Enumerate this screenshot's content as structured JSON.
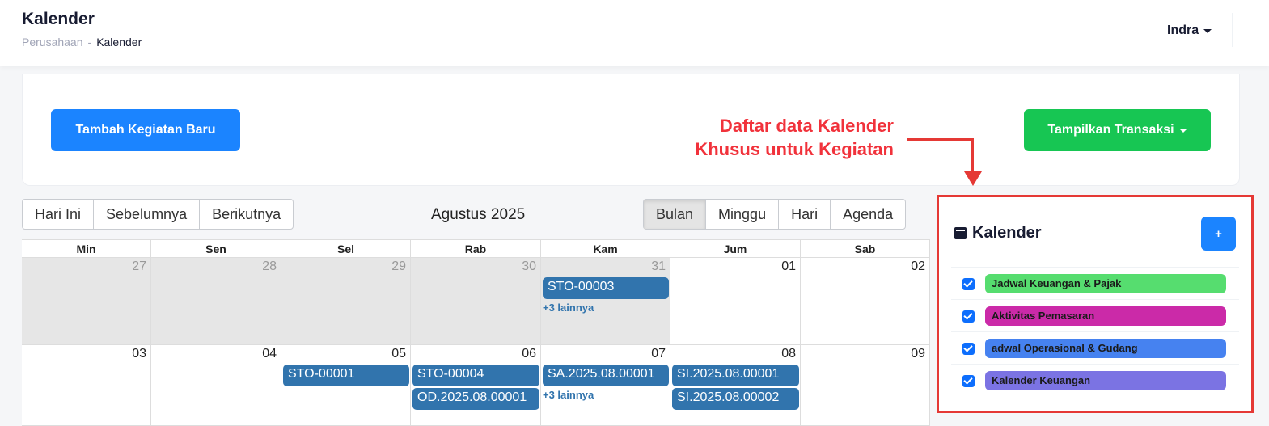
{
  "header": {
    "title": "Kalender",
    "breadcrumb_parent": "Perusahaan",
    "breadcrumb_sep": "-",
    "breadcrumb_current": "Kalender",
    "user": "Indra"
  },
  "actions": {
    "add_label": "Tambah Kegiatan Baru",
    "transaction_label": "Tampilkan Transaksi"
  },
  "annotation": {
    "line1": "Daftar data Kalender",
    "line2": "Khusus untuk Kegiatan"
  },
  "toolbar": {
    "today": "Hari Ini",
    "prev": "Sebelumnya",
    "next": "Berikutnya",
    "month_label": "Agustus 2025",
    "views": [
      "Bulan",
      "Minggu",
      "Hari",
      "Agenda"
    ],
    "active_view": "Bulan"
  },
  "calendar": {
    "weekdays": [
      "Min",
      "Sen",
      "Sel",
      "Rab",
      "Kam",
      "Jum",
      "Sab"
    ],
    "weeks": [
      [
        {
          "day": "27",
          "other": true,
          "events": [],
          "more": ""
        },
        {
          "day": "28",
          "other": true,
          "events": [],
          "more": ""
        },
        {
          "day": "29",
          "other": true,
          "events": [],
          "more": ""
        },
        {
          "day": "30",
          "other": true,
          "events": [],
          "more": ""
        },
        {
          "day": "31",
          "other": true,
          "events": [
            "STO-00003"
          ],
          "more": "+3 lainnya"
        },
        {
          "day": "01",
          "other": false,
          "events": [],
          "more": ""
        },
        {
          "day": "02",
          "other": false,
          "events": [],
          "more": ""
        }
      ],
      [
        {
          "day": "03",
          "other": false,
          "events": [],
          "more": ""
        },
        {
          "day": "04",
          "other": false,
          "events": [],
          "more": ""
        },
        {
          "day": "05",
          "other": false,
          "events": [
            "STO-00001"
          ],
          "more": ""
        },
        {
          "day": "06",
          "other": false,
          "events": [
            "STO-00004",
            "OD.2025.08.00001"
          ],
          "more": ""
        },
        {
          "day": "07",
          "other": false,
          "events": [
            "SA.2025.08.00001"
          ],
          "more": "+3 lainnya"
        },
        {
          "day": "08",
          "other": false,
          "events": [
            "SI.2025.08.00001",
            "SI.2025.08.00002"
          ],
          "more": ""
        },
        {
          "day": "09",
          "other": false,
          "events": [],
          "more": ""
        }
      ]
    ]
  },
  "sidebar": {
    "title": "Kalender",
    "add_label": "+",
    "calendars": [
      {
        "label": "Jadwal Keuangan & Pajak",
        "color": "#56dd6f",
        "text_color": "#1a1a1a",
        "checked": true
      },
      {
        "label": "Aktivitas Pemasaran",
        "color": "#cb2aa8",
        "text_color": "#1a1a1a",
        "checked": true
      },
      {
        "label": "adwal Operasional & Gudang",
        "color": "#4682f0",
        "text_color": "#1a1a1a",
        "checked": true
      },
      {
        "label": "Kalender Keuangan",
        "color": "#7b73e3",
        "text_color": "#1a1a1a",
        "checked": true
      }
    ]
  },
  "colors": {
    "primary": "#1b84ff",
    "success": "#17c653",
    "event": "#3174ad",
    "annotation": "#e53935"
  }
}
